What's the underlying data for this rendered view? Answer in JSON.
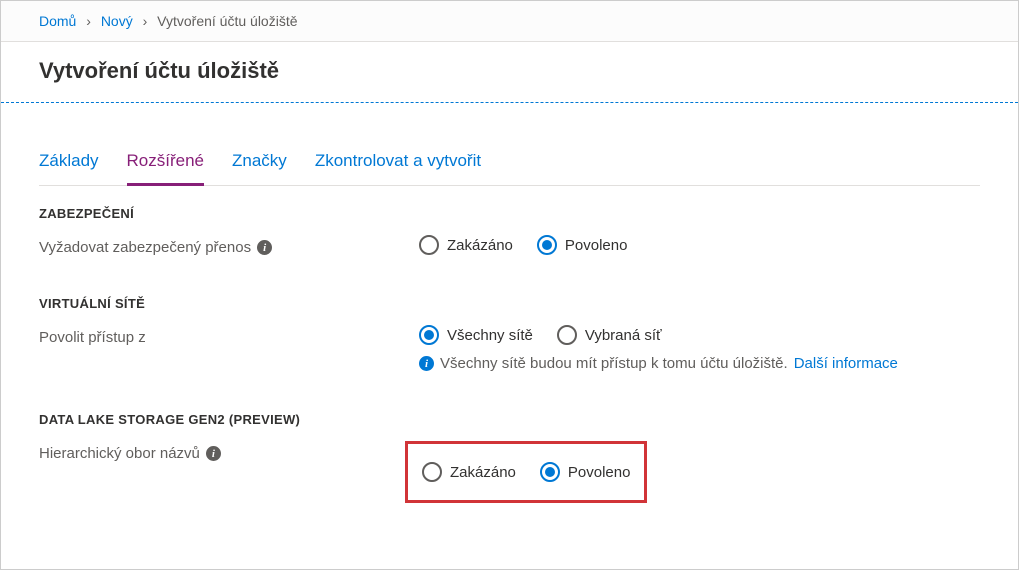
{
  "breadcrumb": {
    "items": [
      {
        "label": "Domů",
        "link": true
      },
      {
        "label": "Nový",
        "link": true
      },
      {
        "label": "Vytvoření účtu úložiště",
        "link": false
      }
    ]
  },
  "page": {
    "title": "Vytvoření účtu úložiště"
  },
  "tabs": [
    {
      "label": "Základy",
      "active": false
    },
    {
      "label": "Rozšířené",
      "active": true
    },
    {
      "label": "Značky",
      "active": false
    },
    {
      "label": "Zkontrolovat a vytvořit",
      "active": false
    }
  ],
  "sections": {
    "security": {
      "heading": "ZABEZPEČENÍ",
      "secureTransfer": {
        "label": "Vyžadovat zabezpečený přenos",
        "options": {
          "disabled": "Zakázáno",
          "enabled": "Povoleno"
        },
        "selected": "enabled"
      }
    },
    "virtualNetworks": {
      "heading": "VIRTUÁLNÍ SÍTĚ",
      "allowAccessFrom": {
        "label": "Povolit přístup z",
        "options": {
          "allNetworks": "Všechny sítě",
          "selectedNetwork": "Vybraná síť"
        },
        "selected": "allNetworks",
        "helpText": "Všechny sítě budou mít přístup k tomu účtu úložiště.",
        "helpLink": "Další informace"
      }
    },
    "dataLake": {
      "heading": "DATA LAKE STORAGE GEN2 (PREVIEW)",
      "hierarchicalNamespace": {
        "label": "Hierarchický obor názvů",
        "options": {
          "disabled": "Zakázáno",
          "enabled": "Povoleno"
        },
        "selected": "enabled"
      }
    }
  }
}
